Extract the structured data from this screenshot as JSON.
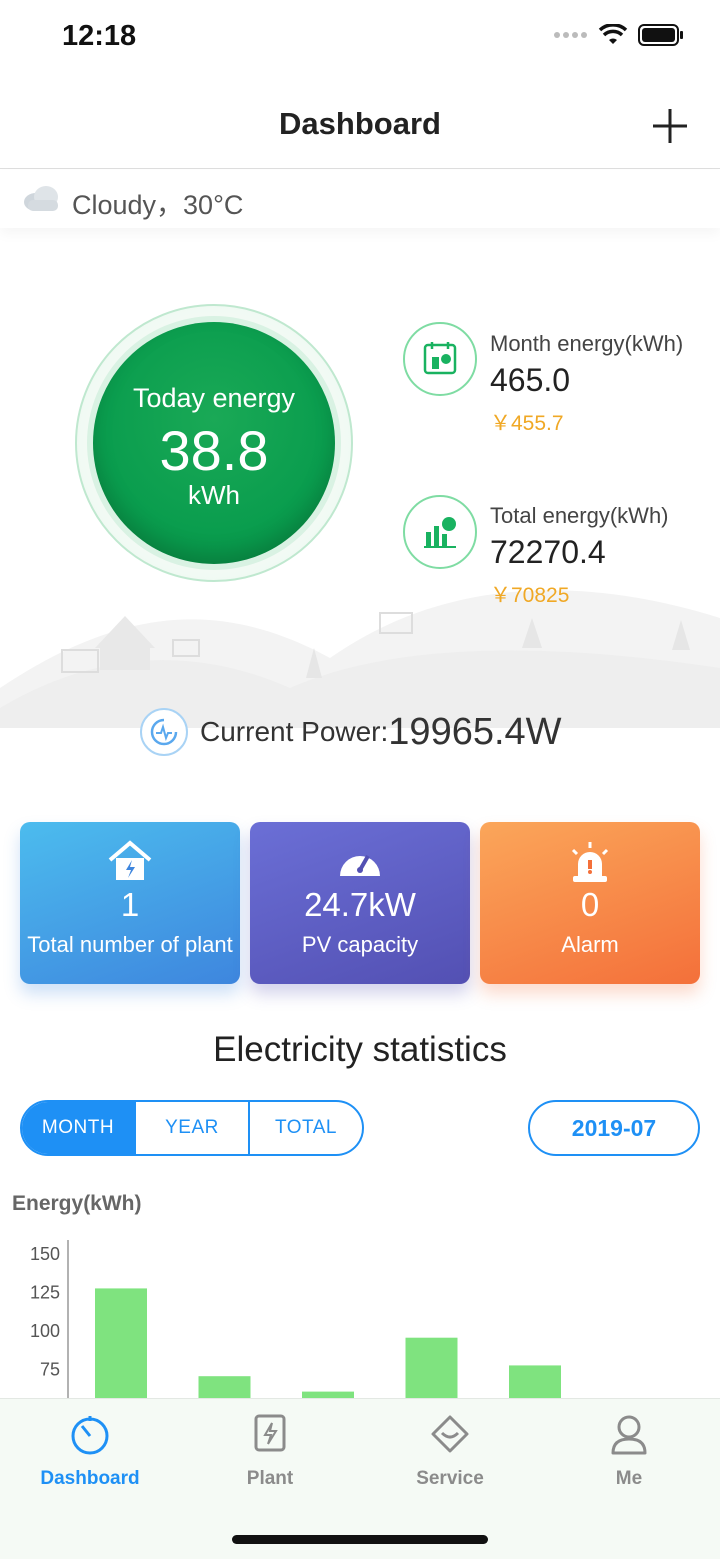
{
  "status_bar": {
    "time": "12:18"
  },
  "header": {
    "title": "Dashboard"
  },
  "weather": {
    "text": "Cloudy，30°C",
    "icon": "cloud-icon"
  },
  "today": {
    "label": "Today energy",
    "value": "38.8",
    "unit": "kWh"
  },
  "month": {
    "label": "Month energy(kWh)",
    "value": "465.0",
    "money": "￥455.7"
  },
  "total": {
    "label": "Total energy(kWh)",
    "value": "72270.4",
    "money": "￥70825"
  },
  "current_power": {
    "label": "Current Power:",
    "value": "19965.4W"
  },
  "cards": {
    "plants": {
      "value": "1",
      "label": "Total number of plant"
    },
    "pv": {
      "value": "24.7kW",
      "label": "PV capacity"
    },
    "alarm": {
      "value": "0",
      "label": "Alarm"
    }
  },
  "stats": {
    "title": "Electricity statistics",
    "tabs": [
      "MONTH",
      "YEAR",
      "TOTAL"
    ],
    "active_tab": "MONTH",
    "date": "2019-07"
  },
  "chart_data": {
    "type": "bar",
    "ylabel": "Energy(kWh)",
    "y_ticks": [
      150,
      125,
      100,
      75
    ],
    "values": [
      127,
      70,
      60,
      95,
      77
    ],
    "color": "#7fe37f"
  },
  "tabbar": {
    "items": [
      {
        "label": "Dashboard",
        "icon": "dashboard-icon",
        "active": true
      },
      {
        "label": "Plant",
        "icon": "plant-icon",
        "active": false
      },
      {
        "label": "Service",
        "icon": "service-icon",
        "active": false
      },
      {
        "label": "Me",
        "icon": "user-icon",
        "active": false
      }
    ]
  },
  "colors": {
    "accent": "#1e90f5",
    "green": "#0a9d4e",
    "money": "#f0a825"
  }
}
